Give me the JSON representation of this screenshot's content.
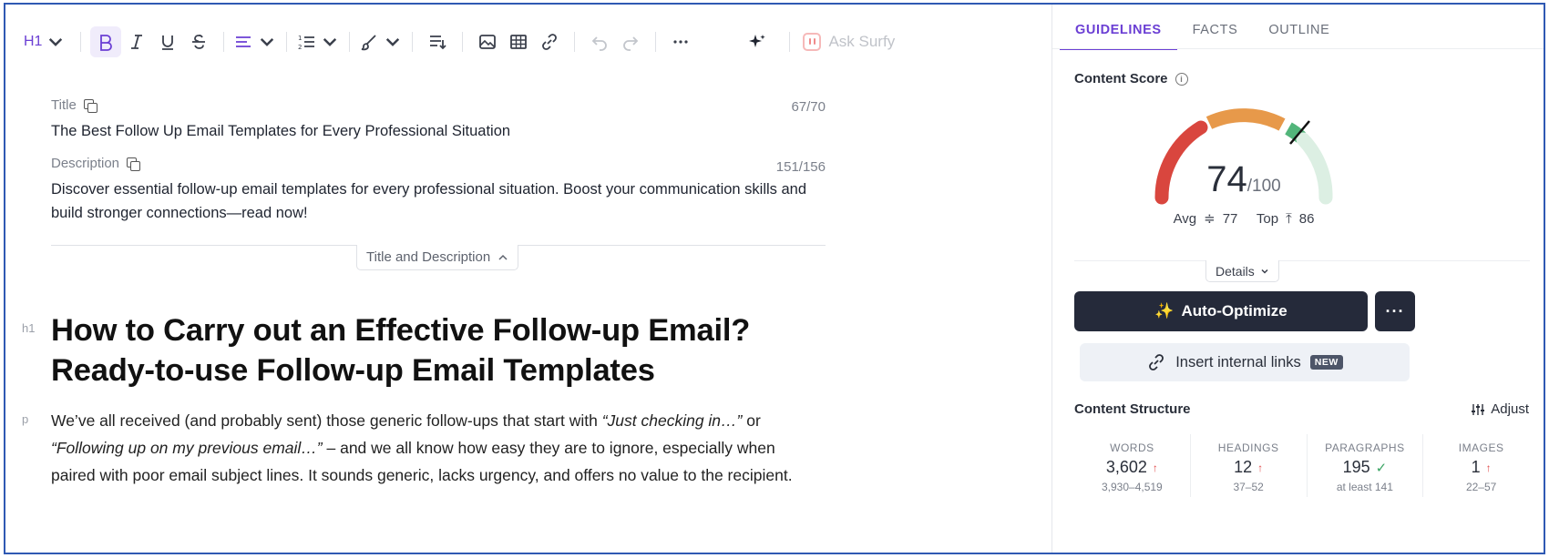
{
  "toolbar": {
    "heading_label": "H1",
    "ask_surfy": "Ask Surfy"
  },
  "meta": {
    "title_label": "Title",
    "title_count": "67/70",
    "title_text": "The Best Follow Up Email Templates for Every Professional Situation",
    "desc_label": "Description",
    "desc_count": "151/156",
    "desc_text": "Discover essential follow-up email templates for every professional situation. Boost your communication skills and build stronger connections—read now!",
    "toggle_label": "Title and Description"
  },
  "content": {
    "h1_gutter": "h1",
    "h1_text": "How to Carry out an Effective Follow-up Email? Ready-to-use Follow-up Email Templates",
    "p_gutter": "p",
    "p_part1": "We’ve all received (and probably sent) those generic follow-ups that start with ",
    "p_em1": "“Just checking in…”",
    "p_part2": " or ",
    "p_em2": "“Following up on my previous email…”",
    "p_part3": " – and we all know how easy they are to ignore, especially when paired with poor email subject lines. It sounds generic, lacks urgency, and offers no value to the recipient."
  },
  "panel": {
    "tabs": [
      "GUIDELINES",
      "FACTS",
      "OUTLINE"
    ],
    "content_score_label": "Content Score",
    "score": "74",
    "score_max": "/100",
    "score_value": 74,
    "avg_label": "Avg",
    "avg_value": "77",
    "top_label": "Top",
    "top_value": "86",
    "details_label": "Details",
    "auto_optimize_label": "Auto-Optimize",
    "insert_links_label": "Insert internal links",
    "new_badge": "NEW",
    "structure_label": "Content Structure",
    "adjust_label": "Adjust",
    "stats": [
      {
        "label": "WORDS",
        "value": "3,602",
        "range": "3,930–4,519",
        "status": "up"
      },
      {
        "label": "HEADINGS",
        "value": "12",
        "range": "37–52",
        "status": "up"
      },
      {
        "label": "PARAGRAPHS",
        "value": "195",
        "range": "at least 141",
        "status": "ok"
      },
      {
        "label": "IMAGES",
        "value": "1",
        "range": "22–57",
        "status": "up"
      }
    ],
    "colors": {
      "gauge_red": "#d9463e",
      "gauge_orange": "#e7994a",
      "gauge_green": "#52b57a",
      "gauge_light": "#dcefe3",
      "accent": "#6b3fd4"
    }
  }
}
